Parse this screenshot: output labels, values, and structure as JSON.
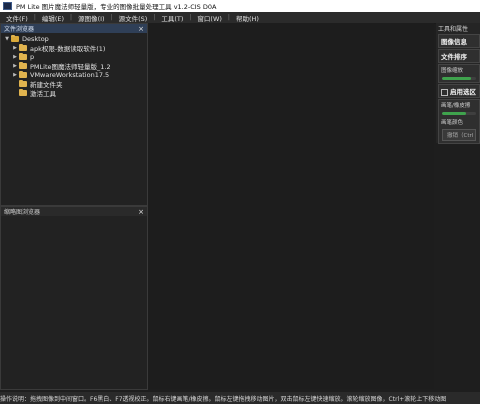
{
  "window": {
    "title": "PM Lite 图片魔法师轻量版，专业的图像批量处理工具 v1.2-CIS D0A"
  },
  "menu": {
    "items": [
      {
        "label": "文件(F)"
      },
      {
        "label": "编辑(E)"
      },
      {
        "label": "源图像(I)"
      },
      {
        "label": "源文件(S)"
      },
      {
        "label": "工具(T)"
      },
      {
        "label": "窗口(W)"
      },
      {
        "label": "帮助(H)"
      }
    ]
  },
  "file_browser": {
    "title": "文件浏览器",
    "close": "×",
    "tree": [
      {
        "label": "Desktop",
        "level": 0,
        "expanded": true
      },
      {
        "label": "apk权限-数据读取软件(1)",
        "level": 1,
        "expanded": false
      },
      {
        "label": "p",
        "level": 1,
        "expanded": false
      },
      {
        "label": "PMLite图魔法师轻量版_1.2",
        "level": 1,
        "expanded": false
      },
      {
        "label": "VMwareWorkstation17.5",
        "level": 1,
        "expanded": false
      },
      {
        "label": "新建文件夹",
        "level": 1,
        "expanded": false
      },
      {
        "label": "激活工具",
        "level": 1,
        "expanded": false
      }
    ]
  },
  "thumb_browser": {
    "title": "缩略图浏览器",
    "close": "×"
  },
  "right_panel": {
    "title": "工具和属性",
    "image_info": "图像信息",
    "file_sort": "文件排序",
    "image_zoom": "图像缩放",
    "zoom_level": 0.85,
    "enable_selection": "启用选区",
    "brush_label": "画笔/橡皮擦",
    "brush_level": 0.7,
    "brush_color_label": "画笔颜色",
    "undo_button": "撤销（Ctrl"
  },
  "status": {
    "text": "操作说明：拖拽图像到中间窗口。F6黑白、F7透视校正。鼠标右键画笔/橡皮擦。鼠标左键拖拽移动图片，双击鼠标左键快速缩放。滚轮缩放图像，Ctrl+滚轮上下移动图"
  }
}
